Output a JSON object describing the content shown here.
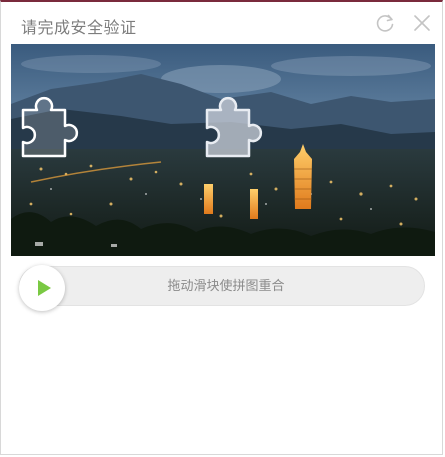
{
  "dialog": {
    "title": "请完成安全验证"
  },
  "header_icons": {
    "refresh": "refresh-icon",
    "close": "close-icon"
  },
  "puzzle": {
    "image": "night-cityscape-with-pagodas-and-mountains",
    "piece_icon": "puzzle-piece-icon",
    "target_icon": "puzzle-slot-icon"
  },
  "slider": {
    "hint": "拖动滑块使拼图重合",
    "handle_icon": "play-icon",
    "accent_color": "#7ac943",
    "progress": 0
  }
}
